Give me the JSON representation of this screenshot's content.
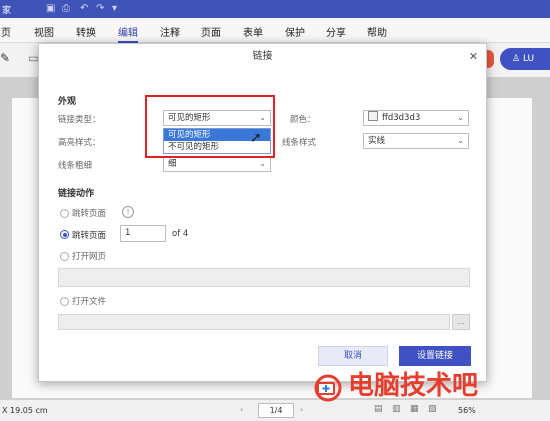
{
  "titlebar": {
    "app_name_fragment": "家"
  },
  "menu": {
    "items": [
      "页",
      "视图",
      "转换",
      "编辑",
      "注释",
      "页面",
      "表单",
      "保护",
      "分享",
      "帮助"
    ],
    "active": "编辑"
  },
  "user_button": {
    "label": "LU"
  },
  "dialog": {
    "title": "链接",
    "appearance": {
      "section": "外观",
      "link_type_label": "链接类型：",
      "link_type_value": "可见的矩形",
      "link_type_options": [
        "可见的矩形",
        "不可见的矩形"
      ],
      "color_label": "颜色：",
      "color_value": "ffd3d3d3",
      "highlight_label": "高亮样式：",
      "line_style_label": "线条样式",
      "line_style_value": "实线",
      "line_width_label": "线条粗细",
      "line_width_value": "细"
    },
    "action": {
      "section": "链接动作",
      "goto_page_1": "跳转页面",
      "goto_page_2": "跳转页面",
      "page_number": "1",
      "page_total": "of 4",
      "open_web": "打开网页",
      "open_file": "打开文件",
      "browse": "..."
    },
    "cancel": "取消",
    "ok": "设置链接"
  },
  "statusbar": {
    "dimension": "X 19.05 cm",
    "page": "1/4",
    "zoom": "56%"
  },
  "watermark": {
    "text": "电脑技术吧"
  },
  "colors": {
    "accent": "#3f51c3",
    "titlebar": "#4054b8",
    "highlight_box": "#e02121",
    "watermark": "#e63e2e"
  }
}
